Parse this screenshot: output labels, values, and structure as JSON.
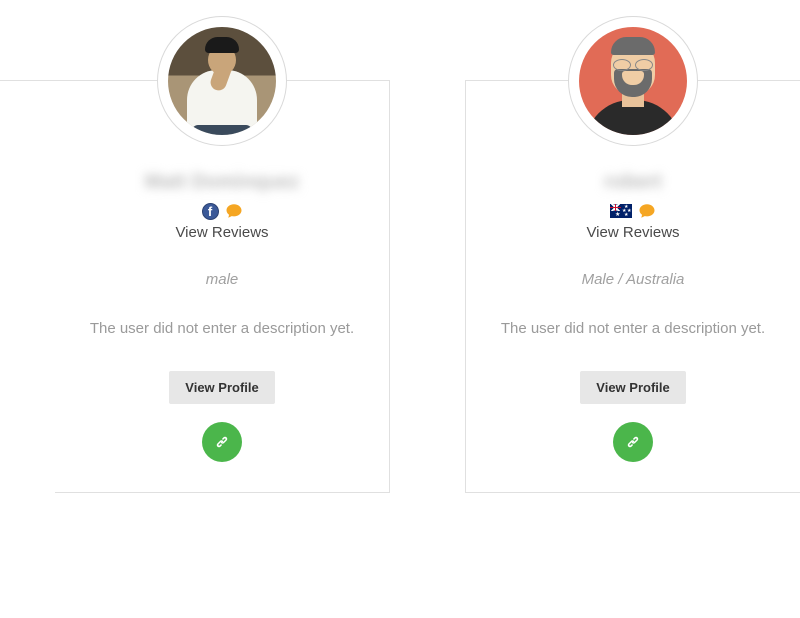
{
  "cards": [
    {
      "username": "Matt Dominquez",
      "reviews_label": "View Reviews",
      "meta": "male",
      "description": "The user did not enter a description yet.",
      "profile_button": "View Profile",
      "badge_type": "facebook"
    },
    {
      "username": "robert",
      "reviews_label": "View Reviews",
      "meta": "Male  /  Australia",
      "description": "The user did not enter a description yet.",
      "profile_button": "View Profile",
      "badge_type": "flag_au"
    }
  ]
}
